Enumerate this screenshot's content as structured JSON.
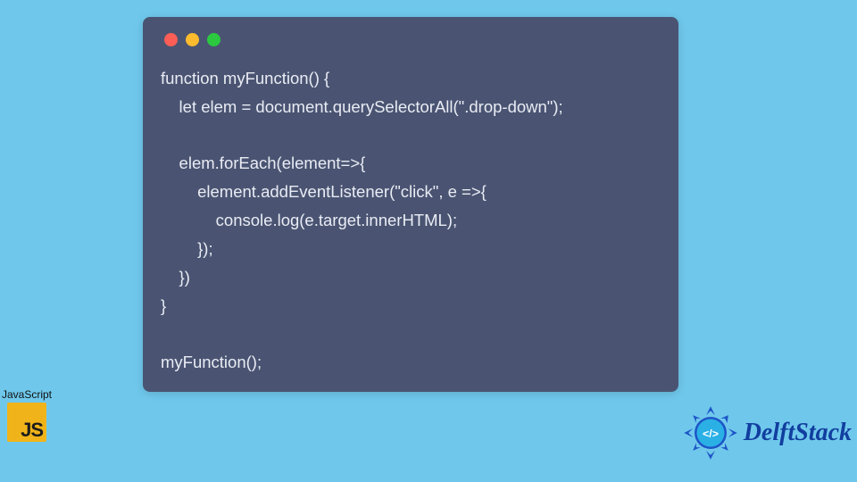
{
  "traffic_lights": {
    "red": "#ff5e57",
    "yellow": "#ffbb2e",
    "green": "#2bc840"
  },
  "code": {
    "l1": "function myFunction() {",
    "l2": "    let elem = document.querySelectorAll(\".drop-down\");",
    "l3": "",
    "l4": "    elem.forEach(element=>{",
    "l5": "        element.addEventListener(\"click\", e =>{",
    "l6": "            console.log(e.target.innerHTML);",
    "l7": "        });",
    "l8": "    })",
    "l9": "}",
    "l10": "",
    "l11": "myFunction();"
  },
  "js_badge": {
    "label": "JavaScript",
    "tile_text": "JS"
  },
  "brand": {
    "name": "DelftStack"
  },
  "colors": {
    "page_bg": "#6fc8ec",
    "window_bg": "#4a5472",
    "code_text": "#e9ecf4",
    "brand_text": "#113e9f",
    "js_tile": "#f0b41a"
  }
}
